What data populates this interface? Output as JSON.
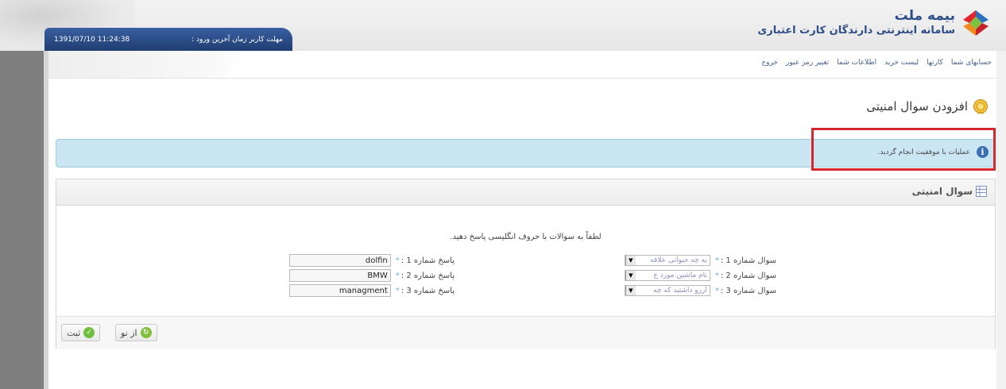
{
  "header": {
    "brand_title": "بیمه ملت",
    "brand_subtitle": "سامانه اینترنتی دارندگان کارت اعتباری",
    "session_label": "مهلت کاربر زمان آخرین ورود :",
    "session_time": "1391/07/10 11:24:38",
    "brand_color": "#2d4d86",
    "accent_color": "#1f3d72"
  },
  "nav": {
    "items": [
      {
        "label": "حسابهای شما"
      },
      {
        "label": "کارتها"
      },
      {
        "label": "لیست خرید"
      },
      {
        "label": "اطلاعات شما"
      },
      {
        "label": "تغییر رمز عبور"
      },
      {
        "label": "خروج"
      }
    ]
  },
  "page": {
    "title": "افزودن سوال امنیتی",
    "title_icon": "badge-icon"
  },
  "message": {
    "text": "عملیات با موفقیت انجام گردید.",
    "icon": "info-icon",
    "highlight_color": "#d8262e",
    "background": "#c9e6f2"
  },
  "panel": {
    "title": "سوال امنیتی",
    "instruction": "لطفاً به سوالات با حروف انگلیسی پاسخ دهید.",
    "questions": [
      {
        "label": "سوال شماره 1 :",
        "required": "*",
        "selected": "به چه حیوانی علاقه"
      },
      {
        "label": "سوال شماره 2 :",
        "required": "*",
        "selected": "نام ماشین مورد ع"
      },
      {
        "label": "سوال شماره 3 :",
        "required": "*",
        "selected": "آرزو داشتید که چه"
      }
    ],
    "answers": [
      {
        "label": "پاسخ شماره 1 :",
        "required": "*",
        "value": "dolfin"
      },
      {
        "label": "پاسخ شماره 2 :",
        "required": "*",
        "value": "BMW"
      },
      {
        "label": "پاسخ شماره 3 :",
        "required": "*",
        "value": "managment"
      }
    ],
    "buttons": {
      "submit_label": "ثبت",
      "reset_label": "از نو"
    }
  }
}
